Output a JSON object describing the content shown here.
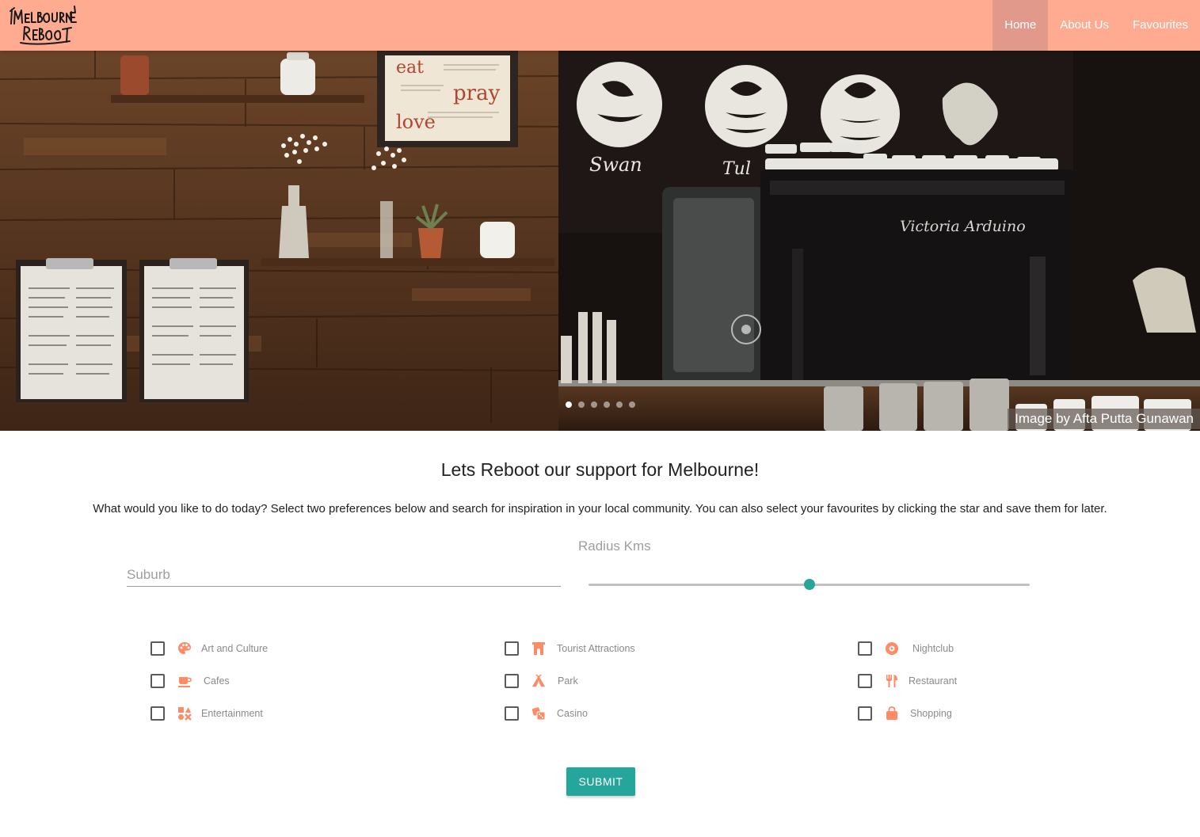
{
  "logo": {
    "line1": "Melbourne",
    "line2": "Reboot"
  },
  "nav": [
    {
      "label": "Home",
      "active": true
    },
    {
      "label": "About Us",
      "active": false
    },
    {
      "label": "Favourites",
      "active": false
    }
  ],
  "carousel": {
    "caption": "Image by Afta Putta Gunawan",
    "slide_count": 6,
    "active_slide": 1,
    "wall_signs": [
      "eat",
      "pray",
      "love"
    ],
    "latte_art_names": [
      "Swan",
      "Tul"
    ],
    "machine_brand": "Victoria Arduino"
  },
  "main": {
    "headline": "Lets Reboot our support for Melbourne!",
    "intro": "What would you like to do today? Select two preferences below and search for inspiration in your local community. You can also select your favourites by clicking the star and save them for later.",
    "suburb_placeholder": "Suburb",
    "radius_label": "Radius Kms",
    "radius_fraction": 0.5
  },
  "preferences": [
    {
      "label": "Art and Culture",
      "icon": "palette-icon",
      "checked": false
    },
    {
      "label": "Cafes",
      "icon": "coffee-cup-icon",
      "checked": false
    },
    {
      "label": "Entertainment",
      "icon": "entertainment-icon",
      "checked": false
    },
    {
      "label": "Tourist Attractions",
      "icon": "landmark-icon",
      "checked": false
    },
    {
      "label": "Park",
      "icon": "tent-icon",
      "checked": false
    },
    {
      "label": "Casino",
      "icon": "dice-icon",
      "checked": false
    },
    {
      "label": "Nightclub",
      "icon": "disc-icon",
      "checked": false
    },
    {
      "label": "Restaurant",
      "icon": "utensils-icon",
      "checked": false
    },
    {
      "label": "Shopping",
      "icon": "shopping-bag-icon",
      "checked": false
    }
  ],
  "submit_label": "SUBMIT",
  "colors": {
    "navbar": "#ffab91",
    "active_nav": "#e0998a",
    "accent": "#26a69a",
    "icon": "#ff8a65"
  }
}
